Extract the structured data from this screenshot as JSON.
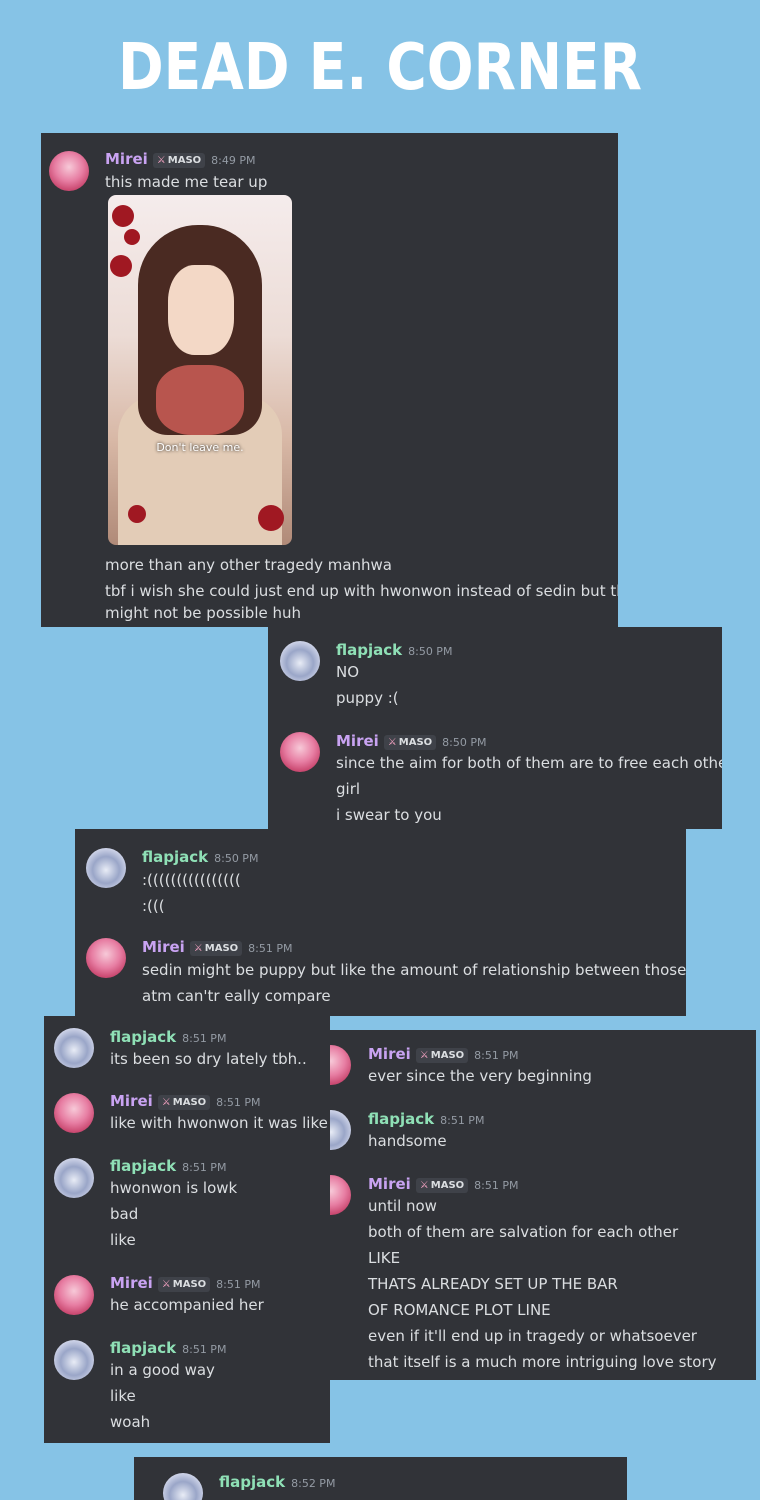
{
  "title": "DEAD E. CORNER",
  "tag_label": "MASO",
  "names": {
    "mirei": "Mirei",
    "flapjack": "flapjack"
  },
  "panel1": {
    "m1": {
      "time": "8:49 PM",
      "lines": [
        "this made me tear up"
      ]
    },
    "image_caption": "Don't leave me.",
    "lines_after": [
      "more than any other tragedy manhwa",
      "tbf i wish she could just end up with hwonwon instead of sedin but that",
      "might not be possible huh"
    ]
  },
  "panel2": {
    "m1": {
      "time": "8:50 PM",
      "lines": [
        "NO",
        "puppy :("
      ]
    },
    "m2": {
      "time": "8:50 PM",
      "lines": [
        "since the aim for both of them are to free each other",
        "girl",
        "i swear to you"
      ]
    }
  },
  "panel3": {
    "m1": {
      "time": "8:50 PM",
      "lines": [
        ":((((((((((((((((",
        ":((("
      ]
    },
    "m2": {
      "time": "8:51 PM",
      "lines": [
        "sedin might be puppy but like the amount of relationship between those two",
        "atm can'tr eally compare"
      ]
    }
  },
  "panel4": {
    "m1": {
      "time": "8:51 PM",
      "lines": [
        "its been so dry lately tbh.."
      ]
    },
    "m2": {
      "time": "8:51 PM",
      "lines": [
        "like with hwonwon it was like"
      ]
    },
    "m3": {
      "time": "8:51 PM",
      "lines": [
        "hwonwon is lowk",
        "bad",
        "like"
      ]
    },
    "m4": {
      "time": "8:51 PM",
      "lines": [
        "he accompanied her"
      ]
    },
    "m5": {
      "time": "8:51 PM",
      "lines": [
        "in a good way",
        "like",
        "woah"
      ]
    }
  },
  "panel5": {
    "m1": {
      "time": "8:51 PM",
      "lines": [
        "ever since the very beginning"
      ]
    },
    "m2": {
      "time": "8:51 PM",
      "lines": [
        "handsome"
      ]
    },
    "m3": {
      "time": "8:51 PM",
      "lines": [
        "until now",
        "both of them are salvation for each other",
        "LIKE",
        "THATS ALREADY SET UP THE BAR",
        "OF ROMANCE PLOT LINE",
        "even if it'll end up in tragedy or whatsoever",
        "that itself is a much more intriguing love story"
      ]
    }
  },
  "panel6": {
    "m1": {
      "time": "8:52 PM"
    }
  }
}
